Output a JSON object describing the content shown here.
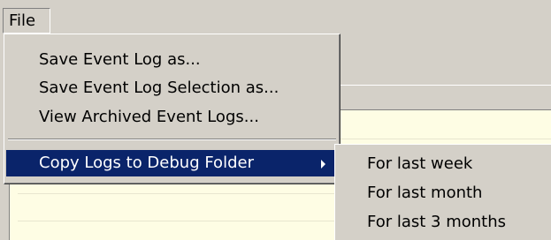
{
  "menubar": {
    "file_label": "File"
  },
  "file_menu": {
    "items": [
      {
        "label": "Save Event Log as..."
      },
      {
        "label": "Save Event Log Selection as..."
      },
      {
        "label": "View Archived Event Logs..."
      },
      {
        "label": "Copy Logs to Debug Folder",
        "selected": true,
        "has_submenu": true
      }
    ]
  },
  "submenu": {
    "items": [
      {
        "label": "For last week"
      },
      {
        "label": "For last month"
      },
      {
        "label": "For last 3 months"
      }
    ]
  },
  "colors": {
    "menu_face": "#d4d0c8",
    "highlight": "#0a246a",
    "list_background": "#fefde4"
  }
}
